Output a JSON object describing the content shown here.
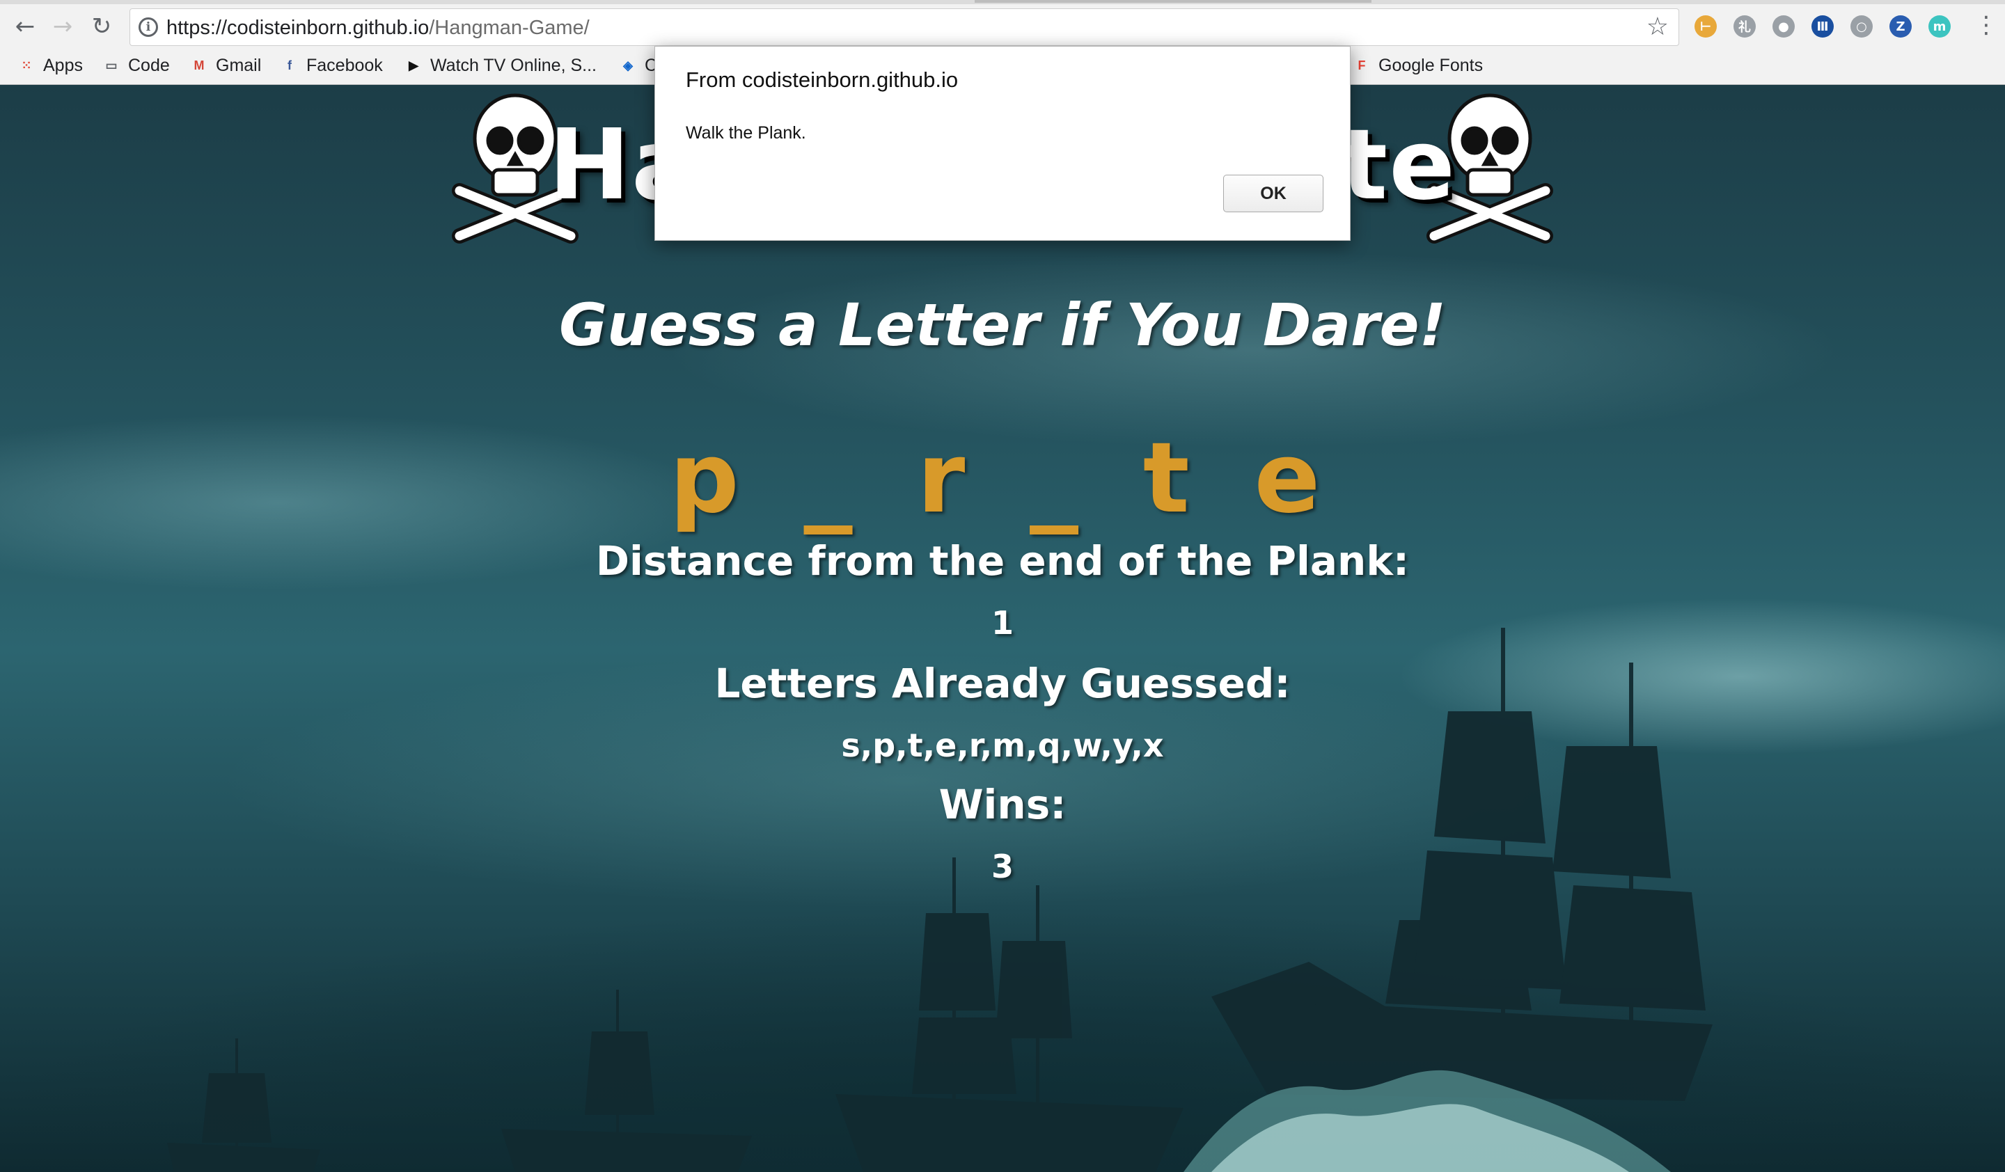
{
  "browser": {
    "url_domain": "https://codisteinborn.github.io",
    "url_path": "/Hangman-Game/",
    "back_icon": "←",
    "forward_icon": "→",
    "reload_icon": "↻",
    "star_icon": "☆",
    "menu_icon": "⋮",
    "extensions": [
      {
        "name": "tag-extension-icon",
        "glyph": "⊢",
        "color": "#e8a83a"
      },
      {
        "name": "kanji-extension-icon",
        "glyph": "礼",
        "color": "#9aa0a6"
      },
      {
        "name": "chat-extension-icon",
        "glyph": "●",
        "color": "#9aa0a6"
      },
      {
        "name": "barcode-extension-icon",
        "glyph": "Ⅲ",
        "color": "#1a4fa0"
      },
      {
        "name": "circle-extension-icon",
        "glyph": "○",
        "color": "#9aa0a6"
      },
      {
        "name": "z-extension-icon",
        "glyph": "Z",
        "color": "#2a5db0"
      },
      {
        "name": "m-extension-icon",
        "glyph": "m",
        "color": "#3cc4c0"
      }
    ]
  },
  "bookmarks": [
    {
      "label": "Apps",
      "icon": "apps-grid-icon",
      "glyph": "⁙",
      "color": "#e04a3a"
    },
    {
      "label": "Code",
      "icon": "folder-icon",
      "glyph": "▭",
      "color": "#5f6368"
    },
    {
      "label": "Gmail",
      "icon": "gmail-icon",
      "glyph": "M",
      "color": "#d44638"
    },
    {
      "label": "Facebook",
      "icon": "facebook-icon",
      "glyph": "f",
      "color": "#3b5998"
    },
    {
      "label": "Watch TV Online, S...",
      "icon": "play-icon",
      "glyph": "▶",
      "color": "#111111"
    },
    {
      "label": "C",
      "icon": "chase-icon",
      "glyph": "◈",
      "color": "#1166cc"
    },
    {
      "label": "Google Fonts",
      "icon": "google-fonts-icon",
      "glyph": "F",
      "color": "#e94235"
    }
  ],
  "game": {
    "title": "Hangman Pirate",
    "subtitle": "Guess a Letter if You Dare!",
    "word": "p _ r _ t e",
    "distance_label": "Distance from the end of the Plank:",
    "distance_value": "1",
    "guessed_label": "Letters Already Guessed:",
    "guessed_value": "s,p,t,e,r,m,q,w,y,x",
    "wins_label": "Wins:",
    "wins_value": "3"
  },
  "alert": {
    "title": "From codisteinborn.github.io",
    "message": "Walk the Plank.",
    "ok_label": "OK"
  },
  "colors": {
    "word_gold": "#d89a2a",
    "sky_dark": "#1c3d47",
    "sky_mid": "#2c6570"
  }
}
